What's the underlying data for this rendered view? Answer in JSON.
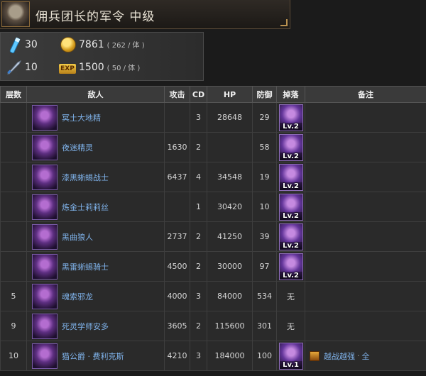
{
  "header": {
    "title": "佣兵团长的军令 中级"
  },
  "info": {
    "stamina": "30",
    "gold": "7861",
    "gold_rate": "( 262 / 体 )",
    "item": "10",
    "exp_badge": "EXP",
    "exp": "1500",
    "exp_rate": "( 50 / 体 )"
  },
  "table": {
    "headers": [
      "层数",
      "敌人",
      "攻击",
      "CD",
      "HP",
      "防御",
      "掉落",
      "备注"
    ],
    "rows": [
      {
        "floor": "",
        "name": "冥土大地精",
        "atk": "",
        "cd": "3",
        "hp": "28648",
        "def": "29",
        "drop": "Lv.2",
        "note": ""
      },
      {
        "floor": "",
        "name": "夜迷精灵",
        "atk": "1630",
        "cd": "2",
        "hp": "",
        "def": "58",
        "drop": "Lv.2",
        "note": ""
      },
      {
        "floor": "",
        "name": "漆黑蜥蜴战士",
        "atk": "6437",
        "cd": "4",
        "hp": "34548",
        "def": "19",
        "drop": "Lv.2",
        "note": ""
      },
      {
        "floor": "",
        "name": "炼金士莉莉丝",
        "atk": "",
        "cd": "1",
        "hp": "30420",
        "def": "10",
        "drop": "Lv.2",
        "note": ""
      },
      {
        "floor": "",
        "name": "黑曲狼人",
        "atk": "2737",
        "cd": "2",
        "hp": "41250",
        "def": "39",
        "drop": "Lv.2",
        "note": ""
      },
      {
        "floor": "",
        "name": "黑雷蜥蜴骑士",
        "atk": "4500",
        "cd": "2",
        "hp": "30000",
        "def": "97",
        "drop": "Lv.2",
        "note": ""
      },
      {
        "floor": "5",
        "name": "魂索邪龙",
        "atk": "4000",
        "cd": "3",
        "hp": "84000",
        "def": "534",
        "drop_text": "无",
        "note": ""
      },
      {
        "floor": "9",
        "name": "死灵学师安多",
        "atk": "3605",
        "cd": "2",
        "hp": "115600",
        "def": "301",
        "drop_text": "无",
        "note": ""
      },
      {
        "floor": "10",
        "name": "猫公爵 · 费利克斯",
        "atk": "4210",
        "cd": "3",
        "hp": "184000",
        "def": "100",
        "drop": "Lv.1",
        "note_link": "越战越强",
        "note_sep": "·",
        "note_link2": "全"
      }
    ]
  }
}
